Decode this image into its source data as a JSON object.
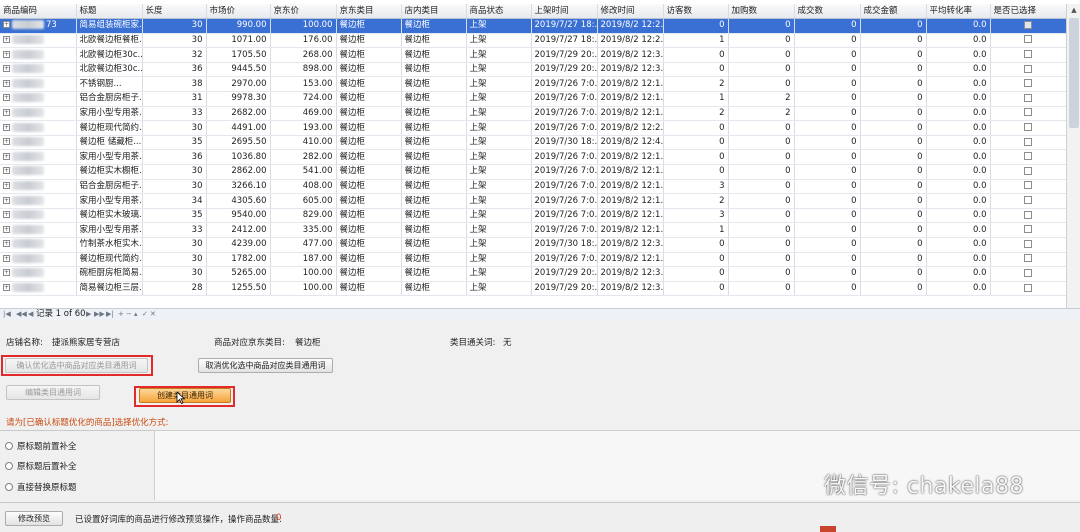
{
  "grid": {
    "columns": [
      "商品编码",
      "标题",
      "长度",
      "市场价",
      "京东价",
      "京东类目",
      "店内类目",
      "商品状态",
      "上架时间",
      "修改时间",
      "访客数",
      "加购数",
      "成交数",
      "成交金额",
      "平均转化率",
      "是否已选择"
    ],
    "rows": [
      {
        "code": "73",
        "title": "简易组装碗柜家...",
        "length": "30",
        "market": "990.00",
        "jd": "100.00",
        "jdcat": "餐边柜",
        "shopcat": "餐边柜",
        "status": "上架",
        "listed": "2019/7/27 18:...",
        "modified": "2019/8/2 12:2...",
        "visitors": "0",
        "carts": "0",
        "deals": "0",
        "amount": "0",
        "rate": "0.0",
        "selected": true
      },
      {
        "code": "",
        "title": "北欧餐边柜餐柜...",
        "length": "30",
        "market": "1071.00",
        "jd": "176.00",
        "jdcat": "餐边柜",
        "shopcat": "餐边柜",
        "status": "上架",
        "listed": "2019/7/27 18:...",
        "modified": "2019/8/2 12:2...",
        "visitors": "1",
        "carts": "0",
        "deals": "0",
        "amount": "0",
        "rate": "0.0",
        "selected": false
      },
      {
        "code": "",
        "title": "北欧餐边柜30c...",
        "length": "32",
        "market": "1705.50",
        "jd": "268.00",
        "jdcat": "餐边柜",
        "shopcat": "餐边柜",
        "status": "上架",
        "listed": "2019/7/29 20:...",
        "modified": "2019/8/2 12:3...",
        "visitors": "0",
        "carts": "0",
        "deals": "0",
        "amount": "0",
        "rate": "0.0",
        "selected": false
      },
      {
        "code": "",
        "title": "北欧餐边柜30c...",
        "length": "36",
        "market": "9445.50",
        "jd": "898.00",
        "jdcat": "餐边柜",
        "shopcat": "餐边柜",
        "status": "上架",
        "listed": "2019/7/29 20:...",
        "modified": "2019/8/2 12:3...",
        "visitors": "0",
        "carts": "0",
        "deals": "0",
        "amount": "0",
        "rate": "0.0",
        "selected": false
      },
      {
        "code": "",
        "title": "不锈钢厨...",
        "length": "38",
        "market": "2970.00",
        "jd": "153.00",
        "jdcat": "餐边柜",
        "shopcat": "餐边柜",
        "status": "上架",
        "listed": "2019/7/26 7:0...",
        "modified": "2019/8/2 12:1...",
        "visitors": "2",
        "carts": "0",
        "deals": "0",
        "amount": "0",
        "rate": "0.0",
        "selected": false
      },
      {
        "code": "",
        "title": "铝合金厨房柜子...",
        "length": "31",
        "market": "9978.30",
        "jd": "724.00",
        "jdcat": "餐边柜",
        "shopcat": "餐边柜",
        "status": "上架",
        "listed": "2019/7/26 7:0...",
        "modified": "2019/8/2 12:1...",
        "visitors": "1",
        "carts": "2",
        "deals": "0",
        "amount": "0",
        "rate": "0.0",
        "selected": false
      },
      {
        "code": "",
        "title": "家用小型专用茶...",
        "length": "33",
        "market": "2682.00",
        "jd": "469.00",
        "jdcat": "餐边柜",
        "shopcat": "餐边柜",
        "status": "上架",
        "listed": "2019/7/26 7:0...",
        "modified": "2019/8/2 12:1...",
        "visitors": "2",
        "carts": "2",
        "deals": "0",
        "amount": "0",
        "rate": "0.0",
        "selected": false
      },
      {
        "code": "",
        "title": "餐边柜现代简约...",
        "length": "30",
        "market": "4491.00",
        "jd": "193.00",
        "jdcat": "餐边柜",
        "shopcat": "餐边柜",
        "status": "上架",
        "listed": "2019/7/26 7:0...",
        "modified": "2019/8/2 12:2...",
        "visitors": "0",
        "carts": "0",
        "deals": "0",
        "amount": "0",
        "rate": "0.0",
        "selected": false
      },
      {
        "code": "",
        "title": "餐边柜 储藏柜...",
        "length": "35",
        "market": "2695.50",
        "jd": "410.00",
        "jdcat": "餐边柜",
        "shopcat": "餐边柜",
        "status": "上架",
        "listed": "2019/7/30 18:...",
        "modified": "2019/8/2 12:4...",
        "visitors": "0",
        "carts": "0",
        "deals": "0",
        "amount": "0",
        "rate": "0.0",
        "selected": false
      },
      {
        "code": "",
        "title": "家用小型专用茶...",
        "length": "36",
        "market": "1036.80",
        "jd": "282.00",
        "jdcat": "餐边柜",
        "shopcat": "餐边柜",
        "status": "上架",
        "listed": "2019/7/26 7:0...",
        "modified": "2019/8/2 12:1...",
        "visitors": "0",
        "carts": "0",
        "deals": "0",
        "amount": "0",
        "rate": "0.0",
        "selected": false
      },
      {
        "code": "",
        "title": "餐边柜实木橱柜...",
        "length": "30",
        "market": "2862.00",
        "jd": "541.00",
        "jdcat": "餐边柜",
        "shopcat": "餐边柜",
        "status": "上架",
        "listed": "2019/7/26 7:0...",
        "modified": "2019/8/2 12:1...",
        "visitors": "0",
        "carts": "0",
        "deals": "0",
        "amount": "0",
        "rate": "0.0",
        "selected": false
      },
      {
        "code": "",
        "title": "铝合金厨房柜子...",
        "length": "30",
        "market": "3266.10",
        "jd": "408.00",
        "jdcat": "餐边柜",
        "shopcat": "餐边柜",
        "status": "上架",
        "listed": "2019/7/26 7:0...",
        "modified": "2019/8/2 12:1...",
        "visitors": "3",
        "carts": "0",
        "deals": "0",
        "amount": "0",
        "rate": "0.0",
        "selected": false
      },
      {
        "code": "",
        "title": "家用小型专用茶...",
        "length": "34",
        "market": "4305.60",
        "jd": "605.00",
        "jdcat": "餐边柜",
        "shopcat": "餐边柜",
        "status": "上架",
        "listed": "2019/7/26 7:0...",
        "modified": "2019/8/2 12:1...",
        "visitors": "2",
        "carts": "0",
        "deals": "0",
        "amount": "0",
        "rate": "0.0",
        "selected": false
      },
      {
        "code": "",
        "title": "餐边柜实木玻璃...",
        "length": "35",
        "market": "9540.00",
        "jd": "829.00",
        "jdcat": "餐边柜",
        "shopcat": "餐边柜",
        "status": "上架",
        "listed": "2019/7/26 7:0...",
        "modified": "2019/8/2 12:1...",
        "visitors": "3",
        "carts": "0",
        "deals": "0",
        "amount": "0",
        "rate": "0.0",
        "selected": false
      },
      {
        "code": "",
        "title": "家用小型专用茶...",
        "length": "33",
        "market": "2412.00",
        "jd": "335.00",
        "jdcat": "餐边柜",
        "shopcat": "餐边柜",
        "status": "上架",
        "listed": "2019/7/26 7:0...",
        "modified": "2019/8/2 12:1...",
        "visitors": "1",
        "carts": "0",
        "deals": "0",
        "amount": "0",
        "rate": "0.0",
        "selected": false
      },
      {
        "code": "",
        "title": "竹制茶水柜实木...",
        "length": "30",
        "market": "4239.00",
        "jd": "477.00",
        "jdcat": "餐边柜",
        "shopcat": "餐边柜",
        "status": "上架",
        "listed": "2019/7/30 18:...",
        "modified": "2019/8/2 12:3...",
        "visitors": "0",
        "carts": "0",
        "deals": "0",
        "amount": "0",
        "rate": "0.0",
        "selected": false
      },
      {
        "code": "",
        "title": "餐边柜现代简约...",
        "length": "30",
        "market": "1782.00",
        "jd": "187.00",
        "jdcat": "餐边柜",
        "shopcat": "餐边柜",
        "status": "上架",
        "listed": "2019/7/26 7:0...",
        "modified": "2019/8/2 12:1...",
        "visitors": "0",
        "carts": "0",
        "deals": "0",
        "amount": "0",
        "rate": "0.0",
        "selected": false
      },
      {
        "code": "",
        "title": "碗柜厨房柜简易...",
        "length": "30",
        "market": "5265.00",
        "jd": "100.00",
        "jdcat": "餐边柜",
        "shopcat": "餐边柜",
        "status": "上架",
        "listed": "2019/7/29 20:...",
        "modified": "2019/8/2 12:3...",
        "visitors": "0",
        "carts": "0",
        "deals": "0",
        "amount": "0",
        "rate": "0.0",
        "selected": false
      },
      {
        "code": "",
        "title": "简易餐边柜三层...",
        "length": "28",
        "market": "1255.50",
        "jd": "100.00",
        "jdcat": "餐边柜",
        "shopcat": "餐边柜",
        "status": "上架",
        "listed": "2019/7/29 20:...",
        "modified": "2019/8/2 12:3...",
        "visitors": "0",
        "carts": "0",
        "deals": "0",
        "amount": "0",
        "rate": "0.0",
        "selected": false
      }
    ]
  },
  "navigator": {
    "record_label": "记录 1 of 60"
  },
  "panel": {
    "shop_name_label": "店铺名称:",
    "shop_name_value": "捷派熊家居专营店",
    "jd_category_label": "商品对应京东类目:",
    "jd_category_value": "餐边柜",
    "category_general_word_label": "类目通关词:",
    "category_general_word_value": "无",
    "confirm_button": "确认优化选中商品对应类目通用词",
    "cancel_button": "取消优化选中商品对应类目通用词",
    "edit_button": "编辑类目通用词",
    "create_button": "创建类目通用词",
    "prompt": "请为[已确认标题优化的商品]选择优化方式:",
    "options": [
      "原标题前置补全",
      "原标题后置补全",
      "直接替换原标题"
    ],
    "preview_button": "修改预览",
    "status_text": "已设置好词库的商品进行修改预览操作，操作商品数量:",
    "status_count": "0"
  },
  "watermark": {
    "text": "微信号: chakela88"
  },
  "colors": {
    "selected_row": "#3a6fd3",
    "highlight_box": "#e32a2a",
    "create_button": "#f5a53a"
  }
}
